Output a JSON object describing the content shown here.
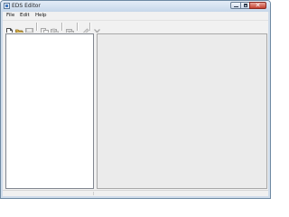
{
  "window": {
    "title": "EDS Editor",
    "icon": "app-icon",
    "caption_icons": [
      "minimize-icon",
      "maximize-icon",
      "close-icon"
    ]
  },
  "menubar": {
    "items": [
      {
        "label": "File"
      },
      {
        "label": "Edit"
      },
      {
        "label": "Help"
      }
    ]
  },
  "toolbar": {
    "buttons": [
      {
        "icon": "new-file-icon",
        "enabled": true
      },
      {
        "icon": "open-folder-icon",
        "enabled": true
      },
      {
        "icon": "save-icon",
        "enabled": false
      },
      {
        "icon": "copy-icon",
        "enabled": false
      },
      {
        "icon": "paste-icon",
        "enabled": false
      },
      {
        "icon": "properties-icon",
        "enabled": false
      },
      {
        "icon": "edit-icon",
        "enabled": false
      },
      {
        "icon": "delete-icon",
        "enabled": false
      }
    ]
  },
  "colors": {
    "frame": "#cfdceb",
    "close_button": "#c4402f",
    "disabled_icon": "#a9a9a9"
  }
}
